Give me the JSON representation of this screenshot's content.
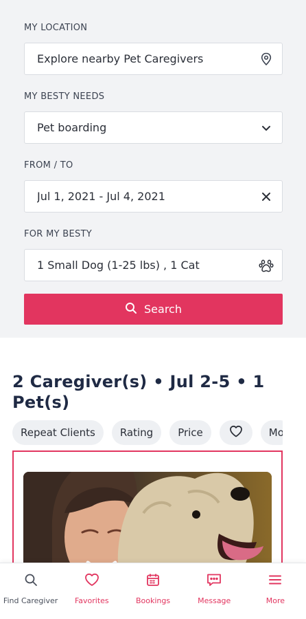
{
  "search_panel": {
    "location": {
      "label": "MY LOCATION",
      "value": "Explore nearby Pet Caregivers",
      "icon": "map-pin-icon"
    },
    "needs": {
      "label": "MY BESTY NEEDS",
      "value": "Pet boarding",
      "icon": "chevron-down-icon"
    },
    "dates": {
      "label": "FROM / TO",
      "value": "Jul 1, 2021 - Jul 4, 2021",
      "icon": "close-icon"
    },
    "pets": {
      "label": "FOR MY BESTY",
      "value": "1 Small Dog (1-25 lbs) , 1 Cat",
      "icon": "paw-icon"
    },
    "search_button": "Search"
  },
  "results": {
    "title": "2 Caregiver(s) • Jul 2-5 • 1 Pet(s)",
    "filters": [
      "Repeat Clients",
      "Rating",
      "Price",
      "Mo"
    ]
  },
  "bottom_nav": {
    "items": [
      {
        "label": "Find Caregiver",
        "icon": "search-icon"
      },
      {
        "label": "Favorites",
        "icon": "heart-icon"
      },
      {
        "label": "Bookings",
        "icon": "calendar-icon"
      },
      {
        "label": "Message",
        "icon": "message-icon"
      },
      {
        "label": "More",
        "icon": "menu-icon"
      }
    ]
  },
  "colors": {
    "accent": "#e2355f",
    "text_dark": "#1f2a44",
    "panel_bg": "#f2f3f5"
  }
}
